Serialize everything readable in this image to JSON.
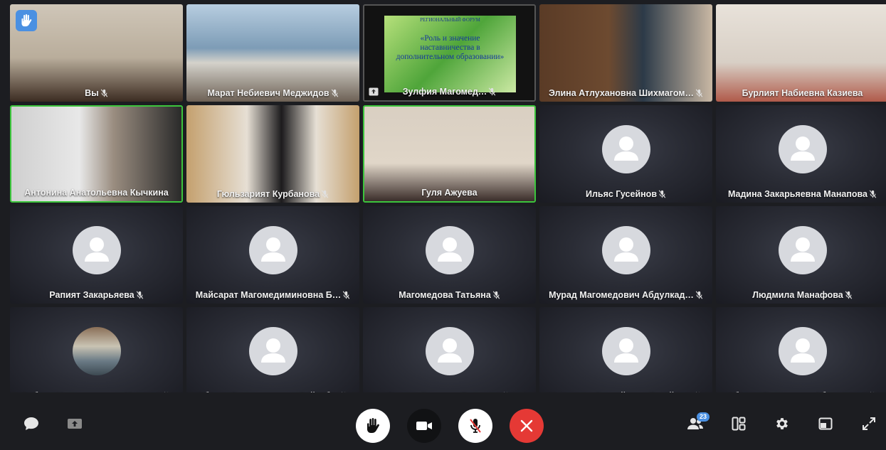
{
  "participants": [
    {
      "name": "Вы",
      "muted": true,
      "kind": "video",
      "hand_raised": true
    },
    {
      "name": "Марат Небиевич Меджидов",
      "muted": true,
      "kind": "video"
    },
    {
      "name": "Зулфия Магомед…",
      "muted": true,
      "kind": "screen",
      "pinned": true
    },
    {
      "name": "Элина Атлухановна Шихмагом…",
      "muted": true,
      "kind": "video"
    },
    {
      "name": "Бурлият Набиевна Казиева",
      "muted": false,
      "kind": "video"
    },
    {
      "name": "Антонина Анатольевна Кычкина",
      "muted": false,
      "kind": "video",
      "speaking": true
    },
    {
      "name": "Гюльзарият Курбанова",
      "muted": true,
      "kind": "video"
    },
    {
      "name": "Гуля Ажуева",
      "muted": false,
      "kind": "video",
      "speaking": true
    },
    {
      "name": "Ильяс Гусейнов",
      "muted": true,
      "kind": "avatar"
    },
    {
      "name": "Мадина Закарьяевна Манапова",
      "muted": true,
      "kind": "avatar"
    },
    {
      "name": "Рапият Закарьяева",
      "muted": true,
      "kind": "avatar"
    },
    {
      "name": "Майсарат Магомедиминовна Б…",
      "muted": true,
      "kind": "avatar"
    },
    {
      "name": "Магомедова Татьяна",
      "muted": true,
      "kind": "avatar"
    },
    {
      "name": "Мурад Магомедович Абдулкад…",
      "muted": true,
      "kind": "avatar"
    },
    {
      "name": "Людмила Манафова",
      "muted": true,
      "kind": "avatar"
    },
    {
      "name": "Сабина Надживудавна Мульд…",
      "muted": true,
      "kind": "photo"
    },
    {
      "name": "Абузар Залимханович Сейкаб…",
      "muted": true,
      "kind": "avatar"
    },
    {
      "name": "Гамзат Алиевич Гамзатов",
      "muted": true,
      "kind": "avatar"
    },
    {
      "name": "Мухминат Закрайовна Гусейно…",
      "muted": true,
      "kind": "avatar"
    },
    {
      "name": "Абидат Османовна Абдуллаева",
      "muted": true,
      "kind": "avatar"
    }
  ],
  "slide": {
    "header": "РЕГИОНАЛЬНЫЙ ФОРУМ",
    "title_lines": [
      "«Роль и значение",
      "наставничества в",
      "дополнительном образовании»"
    ]
  },
  "toolbar": {
    "chat": "chat-icon",
    "share": "share-screen-icon",
    "participants_count": "23",
    "colors": {
      "end_call": "#e53935",
      "accent": "#4a90e2",
      "speaking": "#3cc53c"
    }
  }
}
